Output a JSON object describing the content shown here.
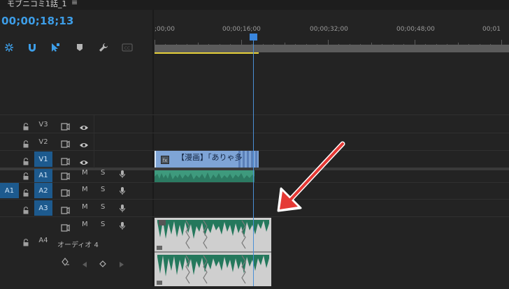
{
  "tab": {
    "title": "モブニコミ1話_1",
    "menu_glyph": "≡"
  },
  "timecode": "00;00;18;13",
  "ruler": {
    "labels": [
      ";00;00",
      "00;00;16;00",
      "00;00;32;00",
      "00;00;48;00",
      "00;01"
    ]
  },
  "tracks": {
    "video": [
      {
        "name": "V3",
        "target": false
      },
      {
        "name": "V2",
        "target": false
      },
      {
        "name": "V1",
        "target": true
      }
    ],
    "audio": [
      {
        "name": "A1",
        "target": true,
        "source": ""
      },
      {
        "name": "A2",
        "target": true,
        "source": "A1"
      },
      {
        "name": "A3",
        "target": true,
        "source": ""
      },
      {
        "name": "A4",
        "target": false,
        "source": "",
        "label": "オーディオ 4"
      }
    ],
    "mute_label": "M",
    "solo_label": "S"
  },
  "clips": {
    "v1_text": "【漫画】「ありゃ多"
  },
  "colors": {
    "accent": "#3d9ee8",
    "track_target": "#1d5a8e",
    "video_clip": "#7ea4d6",
    "audio_clip": "#3e9a7d",
    "annotation_arrow": "#e53935"
  }
}
